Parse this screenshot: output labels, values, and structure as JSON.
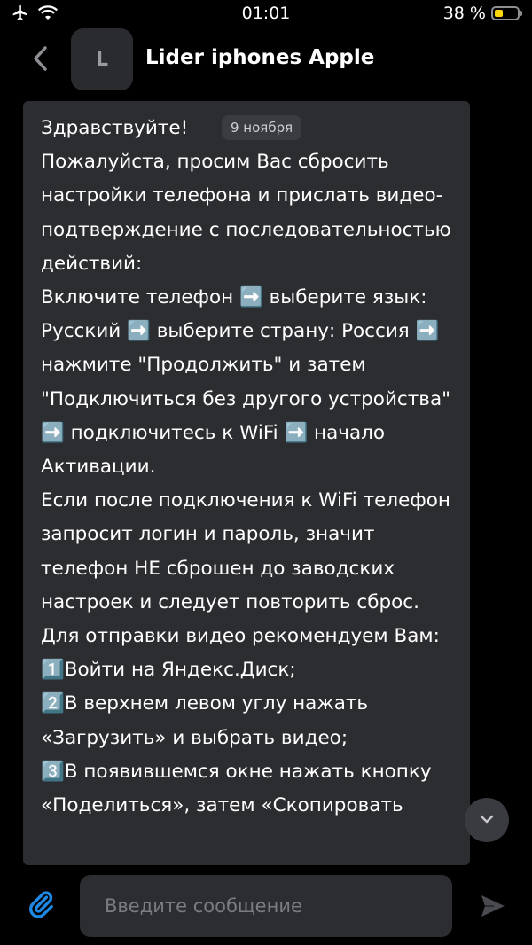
{
  "status_bar": {
    "time": "01:01",
    "battery_percent": "38 %",
    "battery_level": 0.38,
    "icons": [
      "airplane-icon",
      "wifi-icon",
      "battery-icon"
    ]
  },
  "header": {
    "back_icon": "chevron-left-icon",
    "avatar_letter": "L",
    "title": "Lider iphones Apple"
  },
  "message": {
    "date": "9 ноября",
    "text": "Здравствуйте!\nПожалуйста, просим Вас сбросить настройки телефона и прислать видео-подтверждение с последовательностью действий:\nВключите телефон ➡️ выберите язык: Русский ➡️ выберите страну: Россия ➡️ нажмите \"Продолжить\" и затем \"Подключиться без другого устройства\" ➡️ подключитесь к WiFi ➡️ начало Активации.\nЕсли после подключения к WiFi телефон запросит логин и пароль, значит телефон НЕ сброшен до заводских настроек и следует повторить сброс.\nДля отправки видео рекомендуем Вам:\n1️⃣Войти на Яндекс.Диск;\n2️⃣В верхнем левом углу нажать «Загрузить» и выбрать видео;\n3️⃣В появившемся окне нажать кнопку «Поделиться», затем «Скопировать"
  },
  "composer": {
    "placeholder": "Введите сообщение",
    "value": "",
    "attach_icon": "paperclip-icon",
    "send_icon": "send-icon"
  },
  "scroll_down_icon": "chevron-down-icon",
  "colors": {
    "background": "#000000",
    "bubble": "#2c2d31",
    "accent": "#1e88e5",
    "battery": "#ffd60a"
  }
}
